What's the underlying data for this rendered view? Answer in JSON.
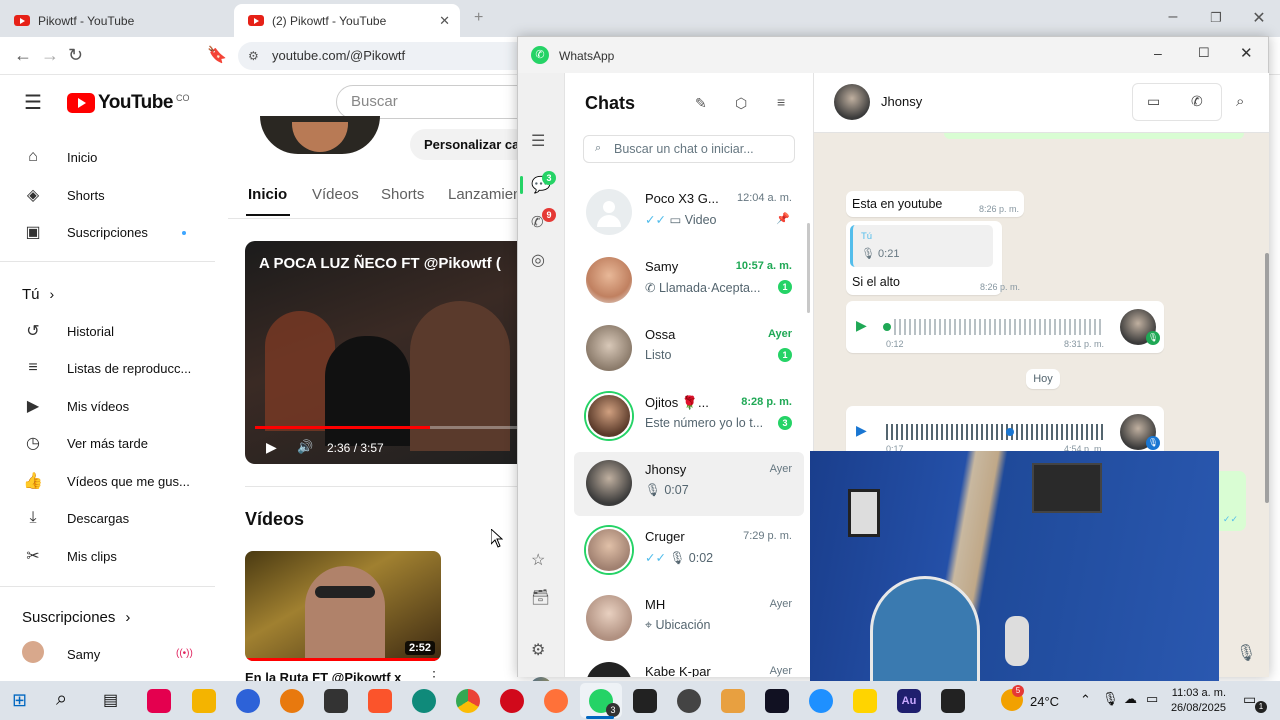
{
  "browser": {
    "tabs": [
      {
        "title": "Pikowtf - YouTube"
      },
      {
        "title": "(2) Pikowtf - YouTube"
      }
    ],
    "new_tab": "+",
    "url": "youtube.com/@Pikowtf"
  },
  "youtube": {
    "logo_text": "YouTube",
    "region": "CO",
    "search_placeholder": "Buscar",
    "customize_label": "Personalizar ca",
    "sidebar": {
      "main": [
        {
          "label": "Inicio",
          "icon": "home-icon"
        },
        {
          "label": "Shorts",
          "icon": "shorts-icon"
        },
        {
          "label": "Suscripciones",
          "icon": "subscriptions-icon"
        }
      ],
      "you_label": "Tú",
      "you_items": [
        {
          "label": "Historial",
          "icon": "history-icon"
        },
        {
          "label": "Listas de reproducc...",
          "icon": "playlists-icon"
        },
        {
          "label": "Mis vídeos",
          "icon": "my-videos-icon"
        },
        {
          "label": "Ver más tarde",
          "icon": "watch-later-icon"
        },
        {
          "label": "Vídeos que me gus...",
          "icon": "liked-icon"
        },
        {
          "label": "Descargas",
          "icon": "downloads-icon"
        },
        {
          "label": "Mis clips",
          "icon": "clips-icon"
        }
      ],
      "subs_label": "Suscripciones",
      "subs": [
        {
          "label": "Samy"
        }
      ]
    },
    "channel_tabs": [
      "Inicio",
      "Vídeos",
      "Shorts",
      "Lanzamien"
    ],
    "featured": {
      "title": "A POCA LUZ ÑECO FT @Pikowtf (",
      "time": "2:36 / 3:57",
      "progress": 0.66
    },
    "videos_heading": "Vídeos",
    "video": {
      "title": "En la Ruta FT @Pikowtf x",
      "duration": "2:52"
    }
  },
  "whatsapp": {
    "window_title": "WhatsApp",
    "rail_badges": {
      "chats": "3",
      "calls": "9"
    },
    "list_title": "Chats",
    "search_placeholder": "Buscar un chat o iniciar...",
    "chats": [
      {
        "name": "Poco X3 G...",
        "time": "12:04 a. m.",
        "preview": "Video",
        "badge": "",
        "pinned": true
      },
      {
        "name": "Samy",
        "time": "10:57 a. m.",
        "preview": "Llamada·Acepta...",
        "badge": "1"
      },
      {
        "name": "Ossa",
        "time": "Ayer",
        "preview": "Listo",
        "badge": "1"
      },
      {
        "name": "Ojitos 🌹...",
        "time": "8:28 p. m.",
        "preview": "Este número yo lo t...",
        "badge": "3"
      },
      {
        "name": "Jhonsy",
        "time": "Ayer",
        "preview": "0:07",
        "badge": ""
      },
      {
        "name": "Cruger",
        "time": "7:29 p. m.",
        "preview": "0:02",
        "badge": ""
      },
      {
        "name": "MH",
        "time": "Ayer",
        "preview": "Ubicación",
        "badge": ""
      },
      {
        "name": "Kabe K-par",
        "time": "Ayer",
        "preview": "",
        "badge": ""
      }
    ],
    "contact": "Jhonsy",
    "messages": {
      "m1_text": "Esta en youtube",
      "m1_time": "8:26 p. m.",
      "quote_author": "Tú",
      "quote_duration": "0:21",
      "m2_text": "Si el alto",
      "m2_time": "8:26 p. m.",
      "voice1_duration": "0:12",
      "voice1_time": "8:31 p. m.",
      "day_label": "Hoy",
      "voice2_duration": "0:17",
      "voice2_time": "4:54 p. m."
    }
  },
  "taskbar": {
    "whatsapp_count": "3",
    "weather": "24°C",
    "weather_badge": "5",
    "clock_time": "11:03 a. m.",
    "clock_date": "26/08/2025",
    "notif_count": "1"
  }
}
